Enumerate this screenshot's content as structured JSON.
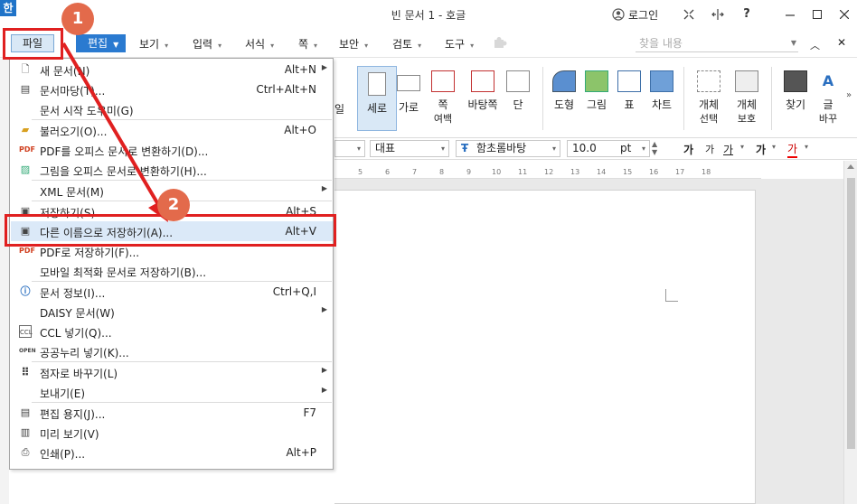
{
  "app": {
    "icon_text": "한",
    "title": "빈 문서 1 - 호글"
  },
  "titlebar": {
    "login_label": "로그인",
    "help_label": "?"
  },
  "menubar": {
    "file_label": "파일",
    "edit_label": "편집",
    "items": [
      {
        "label": "보기"
      },
      {
        "label": "입력"
      },
      {
        "label": "서식"
      },
      {
        "label": "쪽"
      },
      {
        "label": "보안"
      },
      {
        "label": "검토"
      },
      {
        "label": "도구"
      }
    ],
    "search_placeholder": "찾을 내용"
  },
  "ribbon": {
    "buttons": [
      {
        "label": "세로",
        "sub": ""
      },
      {
        "label": "가로",
        "sub": ""
      },
      {
        "label": "쪽",
        "sub": "여백"
      },
      {
        "label": "바탕쪽",
        "sub": ""
      },
      {
        "label": "단",
        "sub": ""
      },
      {
        "label": "도형",
        "sub": ""
      },
      {
        "label": "그림",
        "sub": ""
      },
      {
        "label": "표",
        "sub": ""
      },
      {
        "label": "차트",
        "sub": ""
      },
      {
        "label": "개체",
        "sub": "선택"
      },
      {
        "label": "개체",
        "sub": "보호"
      },
      {
        "label": "찾기",
        "sub": ""
      },
      {
        "label": "글",
        "sub": "바꾸"
      }
    ],
    "partial_label": "일"
  },
  "formatbar": {
    "style": "대표",
    "font": "함초롬바탕",
    "size": "10.0",
    "unit": "pt",
    "char_buttons": [
      "가",
      "가",
      "가",
      "가",
      "가"
    ]
  },
  "ruler": {
    "ticks": [
      "5",
      "6",
      "7",
      "8",
      "9",
      "10",
      "11",
      "12",
      "13",
      "14",
      "15",
      "16",
      "17",
      "18"
    ]
  },
  "file_menu": {
    "items": [
      {
        "label": "새 문서(N)",
        "shortcut": "Alt+N",
        "submenu": true,
        "icon": "new-doc-icon"
      },
      {
        "label": "문서마당(T)...",
        "shortcut": "Ctrl+Alt+N",
        "submenu": false,
        "icon": "template-icon"
      },
      {
        "label": "문서 시작 도우미(G)",
        "shortcut": "",
        "submenu": false,
        "icon": ""
      },
      {
        "label": "불러오기(O)...",
        "shortcut": "Alt+O",
        "submenu": false,
        "icon": "folder-icon"
      },
      {
        "label": "PDF를 오피스 문서로 변환하기(D)...",
        "shortcut": "",
        "submenu": false,
        "icon": "pdf-icon"
      },
      {
        "label": "그림을 오피스 문서로 변환하기(H)...",
        "shortcut": "",
        "submenu": false,
        "icon": "image-convert-icon"
      },
      {
        "label": "XML 문서(M)",
        "shortcut": "",
        "submenu": true,
        "icon": ""
      },
      {
        "label": "저장하기(S)",
        "shortcut": "Alt+S",
        "submenu": false,
        "icon": "save-icon"
      },
      {
        "label": "다른 이름으로 저장하기(A)...",
        "shortcut": "Alt+V",
        "submenu": false,
        "icon": "save-as-icon"
      },
      {
        "label": "PDF로 저장하기(F)...",
        "shortcut": "",
        "submenu": false,
        "icon": "pdf-save-icon"
      },
      {
        "label": "모바일 최적화 문서로 저장하기(B)...",
        "shortcut": "",
        "submenu": false,
        "icon": ""
      },
      {
        "label": "문서 정보(I)...",
        "shortcut": "Ctrl+Q,I",
        "submenu": false,
        "icon": "info-icon"
      },
      {
        "label": "DAISY 문서(W)",
        "shortcut": "",
        "submenu": true,
        "icon": ""
      },
      {
        "label": "CCL 넣기(Q)...",
        "shortcut": "",
        "submenu": false,
        "icon": "ccl-icon"
      },
      {
        "label": "공공누리 넣기(K)...",
        "shortcut": "",
        "submenu": false,
        "icon": "open-icon"
      },
      {
        "label": "점자로 바꾸기(L)",
        "shortcut": "",
        "submenu": true,
        "icon": "braille-icon"
      },
      {
        "label": "보내기(E)",
        "shortcut": "",
        "submenu": true,
        "icon": ""
      },
      {
        "label": "편집 용지(J)...",
        "shortcut": "F7",
        "submenu": false,
        "icon": "page-setup-icon"
      },
      {
        "label": "미리 보기(V)",
        "shortcut": "",
        "submenu": false,
        "icon": "preview-icon"
      },
      {
        "label": "인쇄(P)...",
        "shortcut": "Alt+P",
        "submenu": false,
        "icon": "print-icon"
      }
    ]
  },
  "annotations": {
    "step1": "1",
    "step2": "2",
    "color": "#e02020"
  }
}
